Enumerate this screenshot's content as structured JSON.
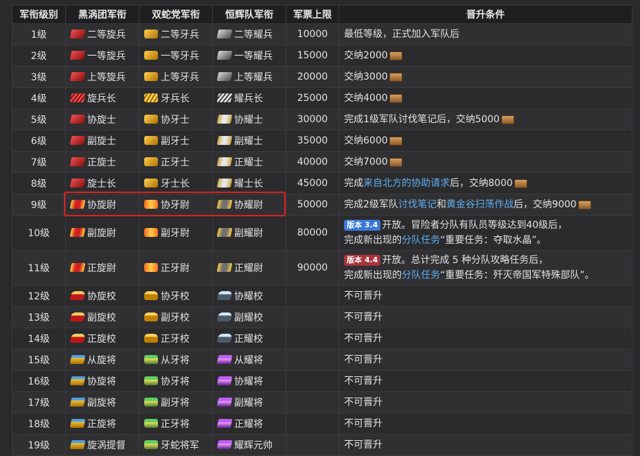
{
  "headers": [
    "军衔级别",
    "黑涡团军衔",
    "双蛇党军衔",
    "恒辉队军衔",
    "军票上限",
    "晋升条件"
  ],
  "rows": [
    {
      "level": "1级",
      "r1": "二等旋兵",
      "r2": "二等牙兵",
      "r3": "二等耀兵",
      "cap": "10000",
      "cond": "最低等级，正式加入军队后"
    },
    {
      "level": "2级",
      "r1": "一等旋兵",
      "r2": "一等牙兵",
      "r3": "一等耀兵",
      "cap": "15000",
      "cond": "交纳2000"
    },
    {
      "level": "3级",
      "r1": "上等旋兵",
      "r2": "上等牙兵",
      "r3": "上等耀兵",
      "cap": "20000",
      "cond": "交纳3000"
    },
    {
      "level": "4级",
      "r1": "旋兵长",
      "r2": "牙兵长",
      "r3": "耀兵长",
      "cap": "25000",
      "cond": "交纳4000"
    },
    {
      "level": "5级",
      "r1": "协旋士",
      "r2": "协牙士",
      "r3": "协耀士",
      "cap": "30000",
      "cond": "完成1级军队讨伐笔记后，交纳5000"
    },
    {
      "level": "6级",
      "r1": "副旋士",
      "r2": "副牙士",
      "r3": "副耀士",
      "cap": "35000",
      "cond": "交纳6000"
    },
    {
      "level": "7级",
      "r1": "正旋士",
      "r2": "正牙士",
      "r3": "正耀士",
      "cap": "40000",
      "cond": "交纳7000"
    },
    {
      "level": "8级",
      "r1": "旋士长",
      "r2": "牙士长",
      "r3": "耀士长",
      "cap": "45000",
      "c8a": "完成",
      "c8b": "来自北方的协助请求",
      "c8c": "后，交纳8000"
    },
    {
      "level": "9级",
      "r1": "协旋尉",
      "r2": "协牙尉",
      "r3": "协耀尉",
      "cap": "50000",
      "c9a": "完成2级军队",
      "c9b": "讨伐笔记",
      "c9c": "和",
      "c9d": "黄金谷扫荡作战",
      "c9e": "后，交纳9000"
    },
    {
      "level": "10级",
      "r1": "副旋尉",
      "r2": "副牙尉",
      "r3": "副耀尉",
      "cap": "80000",
      "badge": "版本 3.4",
      "c10a": "开放。冒险者分队有队员等级达到40级后，",
      "c10b": "完成新出现的",
      "c10c": "分队任务",
      "c10d": "“重要任务：夺取水晶”。"
    },
    {
      "level": "11级",
      "r1": "正旋尉",
      "r2": "正牙尉",
      "r3": "正耀尉",
      "cap": "90000",
      "badge": "版本 4.4",
      "c11a": "开放。总计完成 5 种分队攻略任务后，",
      "c11b": "完成新出现的",
      "c11c": "分队任务",
      "c11d": "“重要任务：歼灭帝国军特殊部队”。"
    },
    {
      "level": "12级",
      "r1": "协旋校",
      "r2": "协牙校",
      "r3": "协耀校",
      "cap": "",
      "cond": "不可晋升"
    },
    {
      "level": "13级",
      "r1": "副旋校",
      "r2": "副牙校",
      "r3": "副耀校",
      "cap": "",
      "cond": "不可晋升"
    },
    {
      "level": "14级",
      "r1": "正旋校",
      "r2": "正牙校",
      "r3": "正耀校",
      "cap": "",
      "cond": "不可晋升"
    },
    {
      "level": "15级",
      "r1": "从旋将",
      "r2": "从牙将",
      "r3": "从耀将",
      "cap": "",
      "cond": "不可晋升"
    },
    {
      "level": "16级",
      "r1": "协旋将",
      "r2": "协牙将",
      "r3": "协耀将",
      "cap": "",
      "cond": "不可晋升"
    },
    {
      "level": "17级",
      "r1": "副旋将",
      "r2": "副牙将",
      "r3": "副耀将",
      "cap": "",
      "cond": "不可晋升"
    },
    {
      "level": "18级",
      "r1": "正旋将",
      "r2": "正牙将",
      "r3": "正耀将",
      "cap": "",
      "cond": "不可晋升"
    },
    {
      "level": "19级",
      "r1": "旋涡提督",
      "r2": "牙蛇将军",
      "r3": "耀辉元帅",
      "cap": "",
      "cond": "不可晋升"
    }
  ],
  "icons": {
    "red": "maelstrom-rank-insignia-icon",
    "gold": "twin-adder-rank-insignia-icon",
    "gray": "immortal-flames-rank-insignia-icon",
    "currency": "company-seal-currency-icon"
  },
  "colors": {
    "link": "#5eb0ee",
    "highlight_border": "#e02020",
    "badge_3_4": "#3a78d8",
    "badge_4_4": "#a8343c"
  },
  "highlighted_row": "9级"
}
